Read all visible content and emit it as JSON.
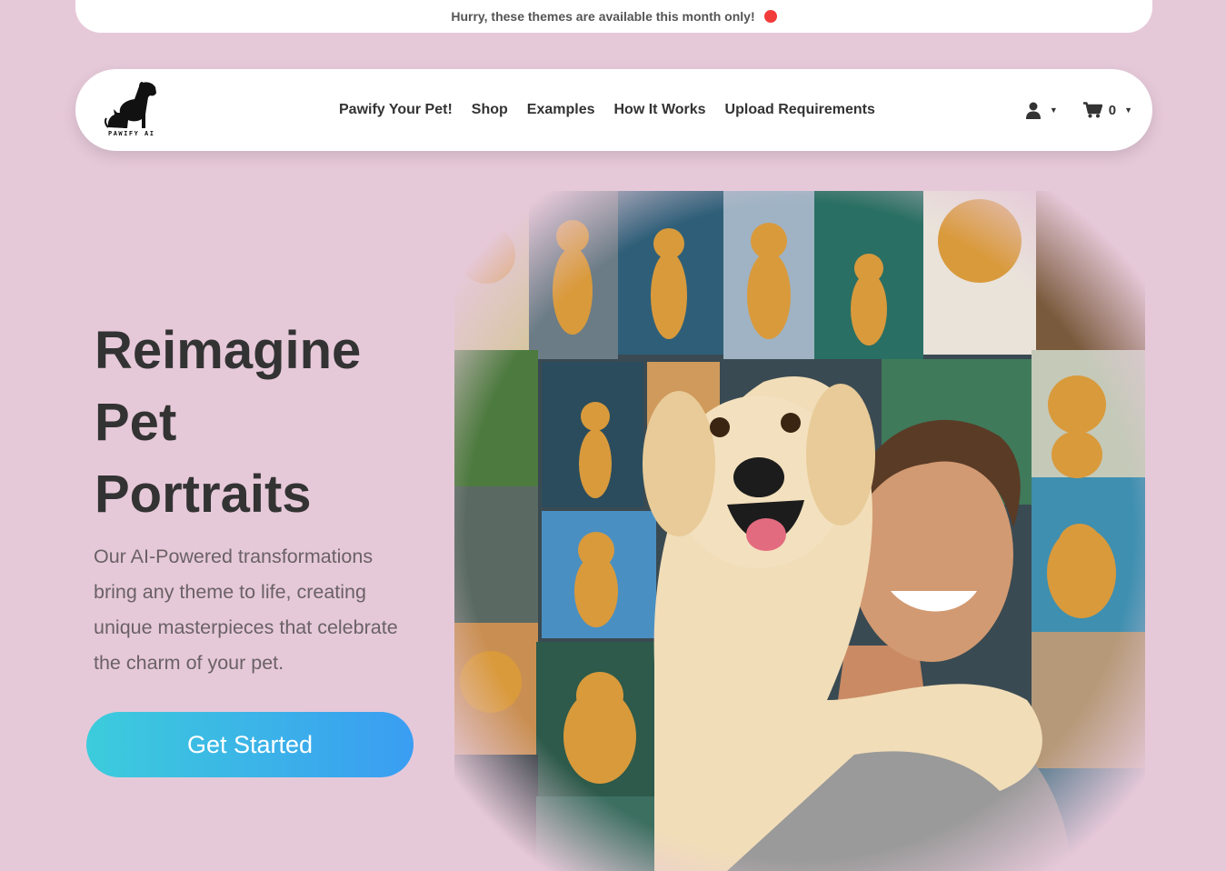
{
  "announcement": {
    "text": "Hurry, these themes are available this month only!"
  },
  "brand": {
    "logo_text": "PAWIFY AI"
  },
  "nav": {
    "links": [
      {
        "label": "Pawify Your Pet!"
      },
      {
        "label": "Shop"
      },
      {
        "label": "Examples"
      },
      {
        "label": "How It Works"
      },
      {
        "label": "Upload Requirements"
      }
    ],
    "account_icon": "user-icon",
    "cart_icon": "cart-icon",
    "cart_count": "0"
  },
  "hero": {
    "title_lines": [
      "Reimagine",
      "Pet",
      "Portraits"
    ],
    "description": "Our AI-Powered transformations bring any theme to life, creating unique masterpieces that celebrate the charm of your pet.",
    "cta_label": "Get Started",
    "image_alt": "golden retriever with smiling man in front of a collage of dog portraits"
  },
  "colors": {
    "background": "#e6c9d9",
    "cta_gradient_start": "#3cccdc",
    "cta_gradient_end": "#3a9df2",
    "status_dot": "#f23b3b",
    "text_dark": "#333333"
  }
}
